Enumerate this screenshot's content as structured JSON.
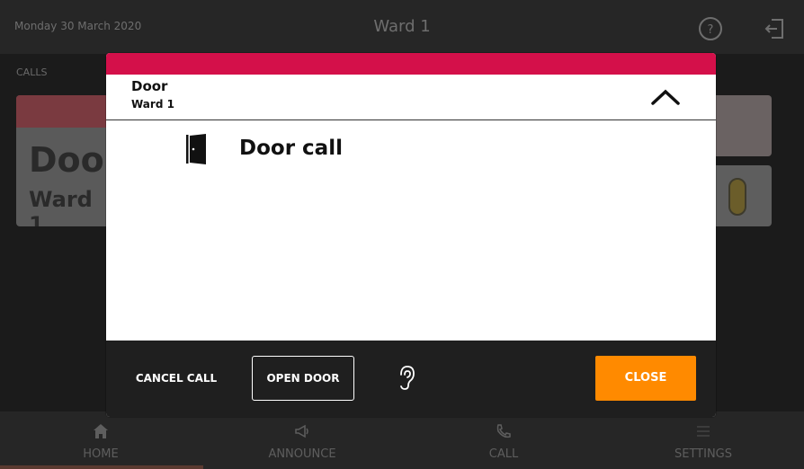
{
  "header": {
    "date": "Monday 30 March 2020",
    "title": "Ward 1",
    "help_icon": "question-circle-icon",
    "logout_icon": "logout-icon"
  },
  "calls_section": {
    "label": "CALLS",
    "card": {
      "name": "Door",
      "sub": "Ward 1"
    }
  },
  "modal": {
    "title": "Door",
    "subtitle": "Ward 1",
    "collapse_icon": "chevron-up-icon",
    "call_icon": "door-icon",
    "call_type": "Door call",
    "buttons": {
      "cancel": "CANCEL CALL",
      "open_door": "OPEN DOOR",
      "listen_icon": "ear-icon",
      "close": "CLOSE"
    },
    "colors": {
      "accent": "#d4104a",
      "close_button": "#ff8a00"
    }
  },
  "bottom_nav": {
    "items": [
      {
        "label": "HOME",
        "icon": "home-icon"
      },
      {
        "label": "ANNOUNCE",
        "icon": "megaphone-icon"
      },
      {
        "label": "CALL",
        "icon": "phone-icon"
      },
      {
        "label": "SETTINGS",
        "icon": "menu-icon"
      }
    ]
  }
}
